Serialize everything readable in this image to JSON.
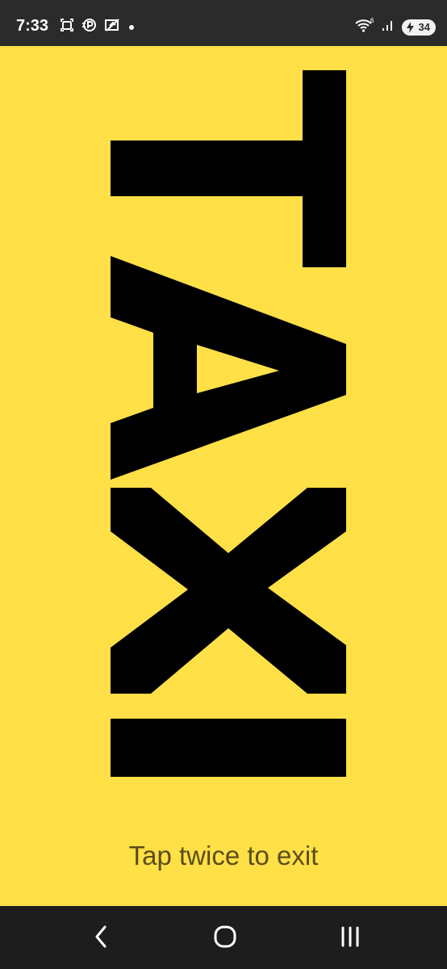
{
  "status_bar": {
    "time": "7:33",
    "battery_level": "34",
    "network_badge": "6",
    "icons": [
      "screenshot-icon",
      "parking-icon",
      "no-sync-icon",
      "notification-dot-icon",
      "wifi-icon",
      "signal-icon",
      "battery-charging-icon"
    ]
  },
  "sign": {
    "text": "TAXI",
    "background_color": "#ffe047",
    "text_color": "#000000"
  },
  "exit_hint": "Tap twice to exit",
  "navigation": {
    "buttons": [
      "back-icon",
      "home-icon",
      "recent-apps-icon"
    ]
  }
}
